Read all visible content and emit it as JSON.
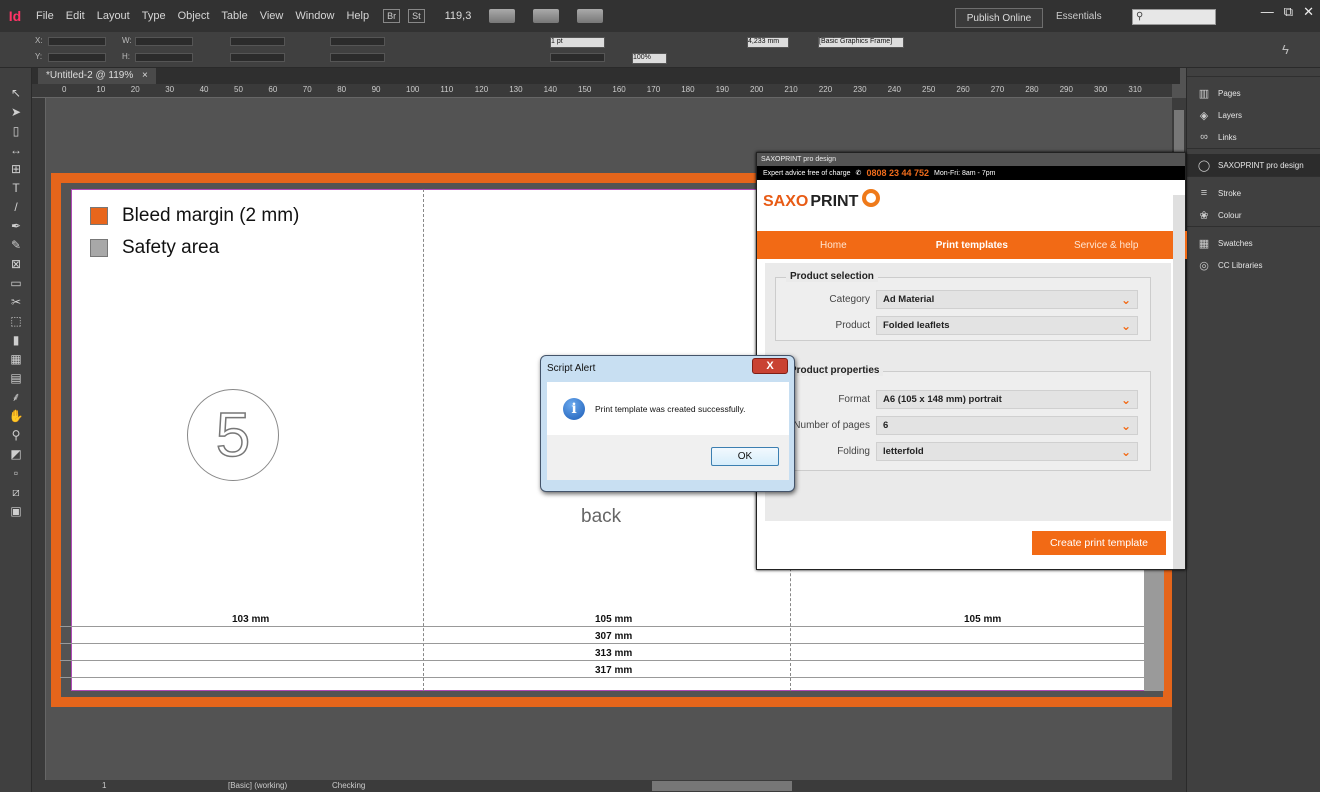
{
  "app": {
    "logo": "Id",
    "menu": [
      "File",
      "Edit",
      "Layout",
      "Type",
      "Object",
      "Table",
      "View",
      "Window",
      "Help"
    ],
    "bridge_buttons": [
      "Br",
      "St"
    ],
    "zoom": "119,3",
    "publish_online": "Publish Online",
    "workspace": "Essentials",
    "window_controls": [
      "—",
      "⧉",
      "✕"
    ]
  },
  "control_panel": {
    "x_label": "X:",
    "y_label": "Y:",
    "w_label": "W:",
    "h_label": "H:",
    "stroke_weight": "1 pt",
    "opacity": "100%",
    "stroke_offset": "4,233 mm",
    "object_style": "[Basic Graphics Frame]"
  },
  "document": {
    "tab_title": "*Untitled-2 @ 119%",
    "ruler_ticks": [
      "0",
      "10",
      "20",
      "30",
      "40",
      "50",
      "60",
      "70",
      "80",
      "90",
      "100",
      "110",
      "120",
      "130",
      "140",
      "150",
      "160",
      "170",
      "180",
      "190",
      "200",
      "210",
      "220",
      "230",
      "240",
      "250",
      "260",
      "270",
      "280",
      "290",
      "300",
      "310"
    ]
  },
  "page_content": {
    "legend": [
      {
        "label": "Bleed margin (2 mm)",
        "color": "#e8661c"
      },
      {
        "label": "Safety area",
        "color": "#a8a8a8"
      }
    ],
    "panel_number": "5",
    "back_label": "back",
    "panel_widths": [
      "103 mm",
      "105 mm",
      "105 mm"
    ],
    "total_widths": [
      "307 mm",
      "313 mm",
      "317 mm"
    ]
  },
  "status_bar": {
    "page_number": "1",
    "master": "[Basic] (working)",
    "preflight": "Checking"
  },
  "right_panels": [
    {
      "label": "Pages",
      "icon": "pages-icon"
    },
    {
      "label": "Layers",
      "icon": "layers-icon"
    },
    {
      "label": "Links",
      "icon": "links-icon"
    },
    {
      "label": "SAXOPRINT pro design",
      "icon": "saxoprint-icon"
    },
    {
      "label": "Stroke",
      "icon": "stroke-icon"
    },
    {
      "label": "Colour",
      "icon": "colour-icon"
    },
    {
      "label": "Swatches",
      "icon": "swatches-icon"
    },
    {
      "label": "CC Libraries",
      "icon": "cc-libraries-icon"
    }
  ],
  "saxoprint": {
    "panel_title": "SAXOPRINT pro design",
    "info_text": "Expert advice free of charge",
    "phone": "0808 23 44 752",
    "hours": "Mon-Fri: 8am - 7pm",
    "logo_saxo": "SAXO",
    "logo_print": "PRINT",
    "nav": [
      "Home",
      "Print templates",
      "Service & help"
    ],
    "active_nav": "Print templates",
    "product_selection": {
      "legend": "Product selection",
      "category_label": "Category",
      "category_value": "Ad Material",
      "product_label": "Product",
      "product_value": "Folded leaflets"
    },
    "product_properties": {
      "legend": "Product properties",
      "format_label": "Format",
      "format_value": "A6 (105 x 148 mm) portrait",
      "pages_label": "Number of pages",
      "pages_value": "6",
      "folding_label": "Folding",
      "folding_value": "letterfold"
    },
    "create_button": "Create print template",
    "accent": "#f26a15"
  },
  "alert": {
    "title": "Script Alert",
    "close": "X",
    "message": "Print template was created successfully.",
    "ok": "OK"
  }
}
